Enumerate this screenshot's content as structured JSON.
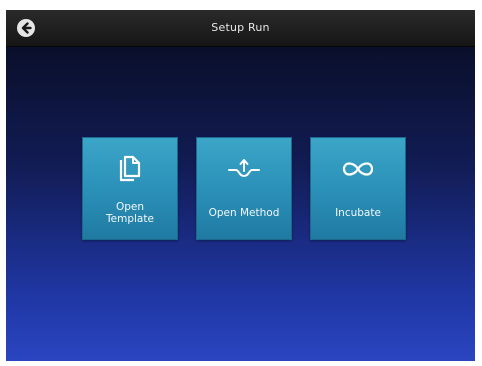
{
  "header": {
    "title": "Setup Run",
    "back_icon": "arrow-left-circle-icon"
  },
  "tiles": [
    {
      "label": "Open\nTemplate",
      "icon": "documents-copy-icon"
    },
    {
      "label": "Open Method",
      "icon": "method-curve-arrow-icon"
    },
    {
      "label": "Incubate",
      "icon": "infinity-icon"
    }
  ],
  "colors": {
    "topbar": "#1e1e1e",
    "tile": "#2a8fb7",
    "background_top": "#0a0f2a",
    "background_bottom": "#2a45c0"
  }
}
